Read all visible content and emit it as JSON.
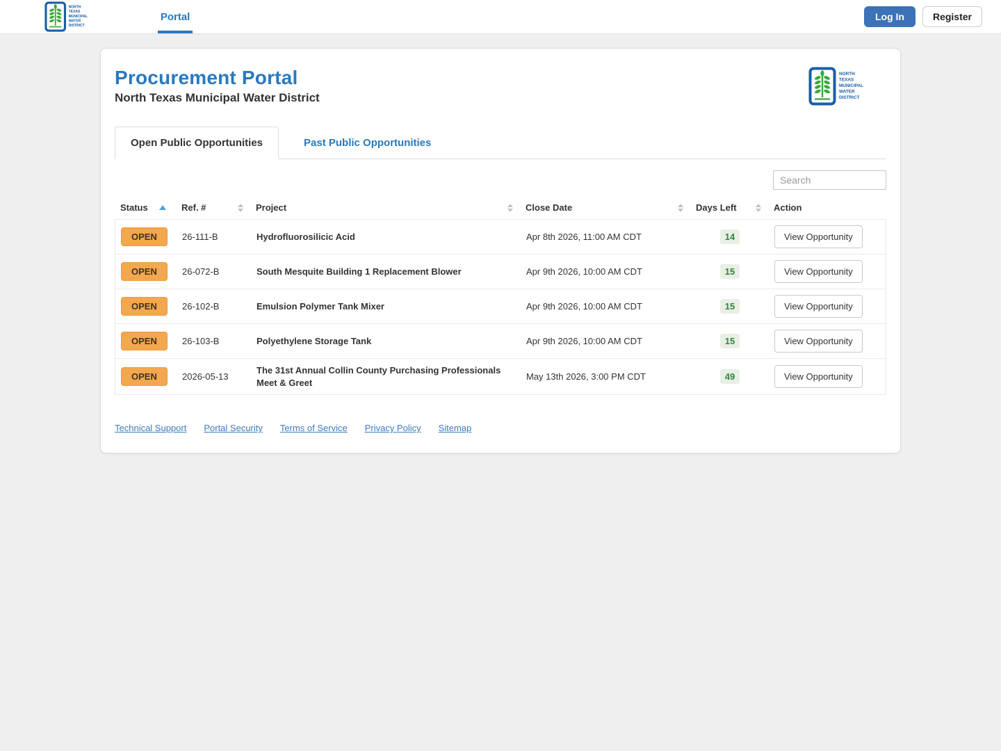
{
  "navbar": {
    "brand_lines": [
      "NORTH",
      "TEXAS",
      "MUNICIPAL",
      "WATER",
      "DISTRICT"
    ],
    "portal_link": "Portal",
    "login_label": "Log In",
    "register_label": "Register"
  },
  "header": {
    "title": "Procurement Portal",
    "subtitle": "North Texas Municipal Water District"
  },
  "tabs": {
    "open_label": "Open Public Opportunities",
    "past_label": "Past Public Opportunities"
  },
  "search": {
    "placeholder": "Search"
  },
  "table": {
    "columns": [
      {
        "label": "Status",
        "sort": "asc"
      },
      {
        "label": "Ref. #",
        "sort": "both"
      },
      {
        "label": "Project",
        "sort": "both"
      },
      {
        "label": "Close Date",
        "sort": "both"
      },
      {
        "label": "Days Left",
        "sort": "both"
      },
      {
        "label": "Action",
        "sort": "none"
      }
    ],
    "rows": [
      {
        "status": "OPEN",
        "ref": "26-111-B",
        "project": "Hydrofluorosilicic Acid",
        "close_date": "Apr 8th 2026, 11:00 AM CDT",
        "days_left": "14",
        "action": "View Opportunity"
      },
      {
        "status": "OPEN",
        "ref": "26-072-B",
        "project": "South Mesquite Building 1 Replacement Blower",
        "close_date": "Apr 9th 2026, 10:00 AM CDT",
        "days_left": "15",
        "action": "View Opportunity"
      },
      {
        "status": "OPEN",
        "ref": "26-102-B",
        "project": "Emulsion Polymer Tank Mixer",
        "close_date": "Apr 9th 2026, 10:00 AM CDT",
        "days_left": "15",
        "action": "View Opportunity"
      },
      {
        "status": "OPEN",
        "ref": "26-103-B",
        "project": "Polyethylene Storage Tank",
        "close_date": "Apr 9th 2026, 10:00 AM CDT",
        "days_left": "15",
        "action": "View Opportunity"
      },
      {
        "status": "OPEN",
        "ref": "2026-05-13",
        "project": "The 31st Annual Collin County Purchasing Professionals Meet & Greet",
        "close_date": "May 13th 2026, 3:00 PM CDT",
        "days_left": "49",
        "action": "View Opportunity"
      }
    ]
  },
  "footer": {
    "links": [
      "Technical Support",
      "Portal Security",
      "Terms of Service",
      "Privacy Policy",
      "Sitemap"
    ]
  },
  "colors": {
    "accent_blue": "#2a79bd",
    "login_button_blue": "#3b72b8",
    "logo_blue": "#1a5fa5",
    "logo_green": "#3aa83a",
    "open_badge_bg": "#f3a74e",
    "days_badge_bg": "#e9efe4",
    "days_badge_text": "#2f8540",
    "footer_link_blue": "#3c7cbe"
  }
}
